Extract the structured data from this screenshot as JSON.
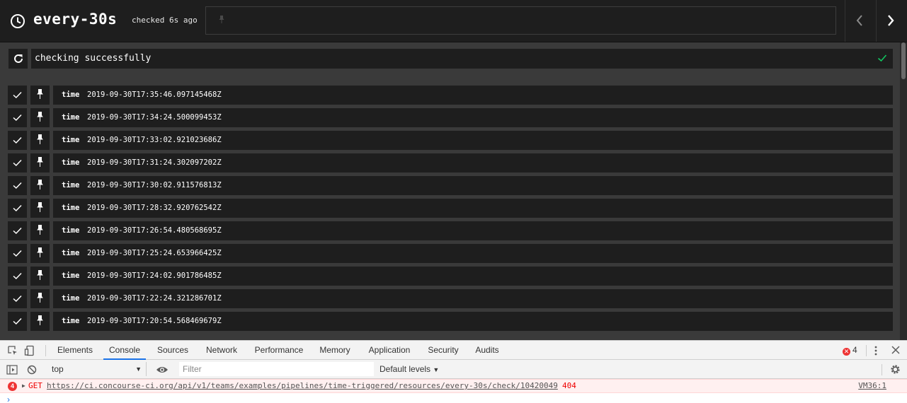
{
  "header": {
    "title": "every-30s",
    "checked_text": "checked 6s ago",
    "icons": {
      "resource": "clock-icon",
      "prev": "chevron-left-icon",
      "next": "chevron-right-icon"
    }
  },
  "check_status": {
    "message": "checking successfully",
    "status_color": "#11c560",
    "icons": {
      "refresh": "refresh-icon",
      "ok": "checkmark-icon"
    }
  },
  "versions": [
    {
      "key": "time",
      "value": "2019-09-30T17:35:46.097145468Z",
      "enabled": true
    },
    {
      "key": "time",
      "value": "2019-09-30T17:34:24.500099453Z",
      "enabled": true
    },
    {
      "key": "time",
      "value": "2019-09-30T17:33:02.921023686Z",
      "enabled": true
    },
    {
      "key": "time",
      "value": "2019-09-30T17:31:24.302097202Z",
      "enabled": true
    },
    {
      "key": "time",
      "value": "2019-09-30T17:30:02.911576813Z",
      "enabled": true
    },
    {
      "key": "time",
      "value": "2019-09-30T17:28:32.920762542Z",
      "enabled": true
    },
    {
      "key": "time",
      "value": "2019-09-30T17:26:54.480568695Z",
      "enabled": true
    },
    {
      "key": "time",
      "value": "2019-09-30T17:25:24.653966425Z",
      "enabled": true
    },
    {
      "key": "time",
      "value": "2019-09-30T17:24:02.901786485Z",
      "enabled": true
    },
    {
      "key": "time",
      "value": "2019-09-30T17:22:24.321286701Z",
      "enabled": true
    },
    {
      "key": "time",
      "value": "2019-09-30T17:20:54.568469679Z",
      "enabled": true
    }
  ],
  "devtools": {
    "tabs": [
      "Elements",
      "Console",
      "Sources",
      "Network",
      "Performance",
      "Memory",
      "Application",
      "Security",
      "Audits"
    ],
    "active_tab": "Console",
    "error_count": "4",
    "context": "top",
    "filter_placeholder": "Filter",
    "levels": "Default levels",
    "error": {
      "count": "4",
      "method": "GET",
      "url": "https://ci.concourse-ci.org/api/v1/teams/examples/pipelines/time-triggered/resources/every-30s/check/10420049",
      "status": "404",
      "source": "VM36:1"
    },
    "prompt": "›"
  }
}
